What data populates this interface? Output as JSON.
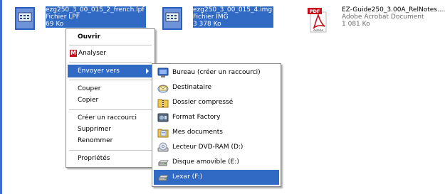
{
  "files": [
    {
      "name": "ezg250_3_00_015_2_french.lpf",
      "type": "Fichier LPF",
      "size": "69 Ko",
      "selected": true
    },
    {
      "name": "ezg250_3_00_015_4.img",
      "type": "Fichier IMG",
      "size": "3 378 Ko",
      "selected": true
    },
    {
      "name": "EZ-Guide250_3.00A_RelNotes....",
      "type": "Adobe Acrobat Document",
      "size": "1 081 Ko",
      "selected": false,
      "badge": "PDF",
      "brand": "Adobe"
    }
  ],
  "context_menu": {
    "open": "Ouvrir",
    "analyze": "Analyser",
    "analyze_badge": "M",
    "send_to": "Envoyer vers",
    "cut": "Couper",
    "copy": "Copier",
    "create_shortcut": "Créer un raccourci",
    "delete": "Supprimer",
    "rename": "Renommer",
    "properties": "Propriétés"
  },
  "send_to_menu": [
    {
      "label": "Bureau (créer un raccourci)",
      "icon": "desktop-icon"
    },
    {
      "label": "Destinataire",
      "icon": "mail-recipient-icon"
    },
    {
      "label": "Dossier compressé",
      "icon": "zip-folder-icon"
    },
    {
      "label": "Format Factory",
      "icon": "format-factory-icon"
    },
    {
      "label": "Mes documents",
      "icon": "my-documents-icon"
    },
    {
      "label": "Lecteur DVD-RAM (D:)",
      "icon": "dvd-drive-icon"
    },
    {
      "label": "Disque amovible (E:)",
      "icon": "removable-disk-icon"
    },
    {
      "label": "Lexar (F:)",
      "icon": "removable-disk-icon",
      "highlighted": true
    }
  ],
  "colors": {
    "selection": "#316ac5",
    "accent_bar": "#3c6fd0",
    "pdf_red": "#c8101c"
  }
}
